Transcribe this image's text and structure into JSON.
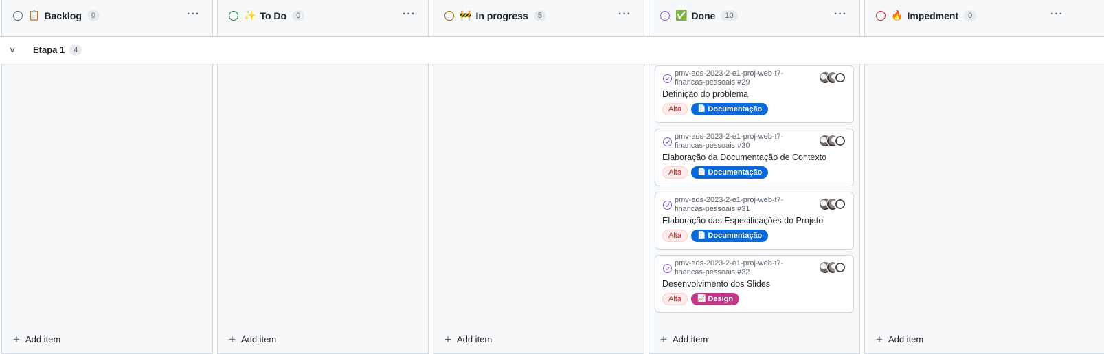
{
  "columns": [
    {
      "title": "Backlog",
      "count": "0",
      "emoji": "📋",
      "circle_color": "#59636e",
      "add_label": "Add item"
    },
    {
      "title": "To Do",
      "count": "0",
      "emoji": "✨",
      "circle_color": "#1a7f37",
      "add_label": "Add item"
    },
    {
      "title": "In progress",
      "count": "5",
      "emoji": "🚧",
      "circle_color": "#9a6700",
      "add_label": "Add item"
    },
    {
      "title": "Done",
      "count": "10",
      "emoji": "✅",
      "circle_color": "#8250df",
      "add_label": "Add item"
    },
    {
      "title": "Impedment",
      "count": "0",
      "emoji": "🔥",
      "circle_color": "#cf222e",
      "add_label": "Add item"
    }
  ],
  "more_label": "···",
  "group": {
    "title": "Etapa 1",
    "count": "4"
  },
  "cards": [
    {
      "repo": "pmv-ads-2023-2-e1-proj-web-t7-financas-pessoais #29",
      "title": "Definição do problema",
      "priority": "Alta",
      "tag": "Documentação",
      "tag_icon": "📄",
      "tag_type": "doc"
    },
    {
      "repo": "pmv-ads-2023-2-e1-proj-web-t7-financas-pessoais #30",
      "title": "Elaboração da Documentação de Contexto",
      "priority": "Alta",
      "tag": "Documentação",
      "tag_icon": "📄",
      "tag_type": "doc"
    },
    {
      "repo": "pmv-ads-2023-2-e1-proj-web-t7-financas-pessoais #31",
      "title": "Elaboração das Especificações do Projeto",
      "priority": "Alta",
      "tag": "Documentação",
      "tag_icon": "📄",
      "tag_type": "doc"
    },
    {
      "repo": "pmv-ads-2023-2-e1-proj-web-t7-financas-pessoais #32",
      "title": "Desenvolvimento dos Slides",
      "priority": "Alta",
      "tag": "Design",
      "tag_icon": "📈",
      "tag_type": "design"
    }
  ]
}
